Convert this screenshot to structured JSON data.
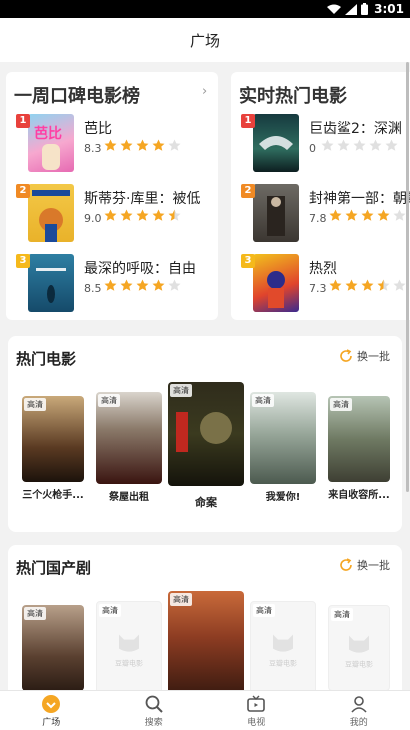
{
  "status_bar": {
    "time": "3:01"
  },
  "header": {
    "title": "广场"
  },
  "weekly_rank": {
    "title": "一周口碑电影榜",
    "items": [
      {
        "rank": "1",
        "name": "芭比",
        "score": "8.3",
        "stars": 4
      },
      {
        "rank": "2",
        "name": "斯蒂芬·库里：被低",
        "score": "9.0",
        "stars": 4.5
      },
      {
        "rank": "3",
        "name": "最深的呼吸：自由",
        "score": "8.5",
        "stars": 4
      }
    ]
  },
  "hot_now": {
    "title": "实时热门电影",
    "items": [
      {
        "rank": "1",
        "name": "巨齿鲨2：深渊",
        "score": "0",
        "stars": 0
      },
      {
        "rank": "2",
        "name": "封神第一部：朝歌",
        "score": "7.8",
        "stars": 4
      },
      {
        "rank": "3",
        "name": "热烈",
        "score": "7.3",
        "stars": 3.5
      }
    ]
  },
  "hot_movies": {
    "title": "热门电影",
    "refresh_label": "换一批",
    "hd_label": "高清",
    "items": [
      {
        "title": "三个火枪手..."
      },
      {
        "title": "祭屋出租"
      },
      {
        "title": "命案"
      },
      {
        "title": "我爱你!"
      },
      {
        "title": "来自收容所..."
      }
    ]
  },
  "hot_tv": {
    "title": "热门国产剧",
    "refresh_label": "换一批",
    "hd_label": "高清",
    "placeholder_text": "豆瓣电影"
  },
  "nav": {
    "items": [
      {
        "label": "广场"
      },
      {
        "label": "搜索"
      },
      {
        "label": "电视"
      },
      {
        "label": "我的"
      }
    ]
  },
  "colors": {
    "accent": "#f5a623",
    "rank1": "#e8413c",
    "rank2": "#f08a24",
    "rank3": "#f5b91b"
  }
}
